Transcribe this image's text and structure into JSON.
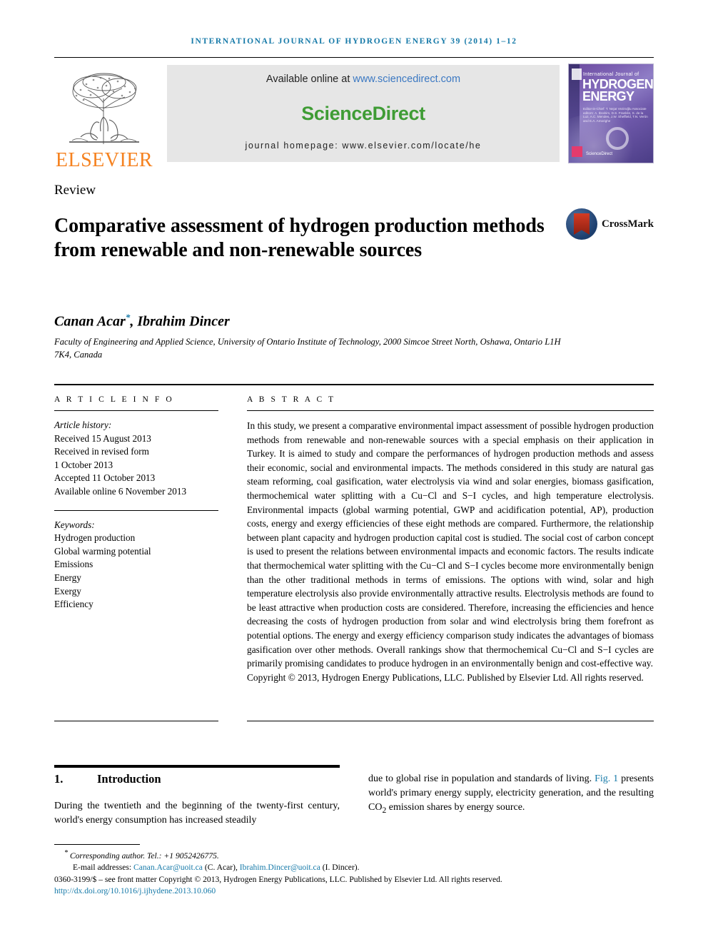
{
  "running_head": "International Journal of Hydrogen Energy 39 (2014) 1–12",
  "masthead": {
    "publisher_name": "ELSEVIER",
    "available_prefix": "Available online at ",
    "available_url": "www.sciencedirect.com",
    "brand": "ScienceDirect",
    "homepage": "journal homepage: www.elsevier.com/locate/he",
    "cover": {
      "line1": "International Journal of",
      "line2": "HYDROGEN",
      "line3": "ENERGY",
      "editors": "Editor-in-Chief: T. Nejat Veziroğlu  Associate editors: A. Ibrahim, D.S. Franklin, S. de la Luz, A.C. Mendes, J.W. Sheffield, T.N. Verón and E.A. Amorighe",
      "sciencedirect_mark": "ScienceDirect"
    }
  },
  "article": {
    "doctype": "Review",
    "title": "Comparative assessment of hydrogen production methods from renewable and non-renewable sources",
    "crossmark_label": "CrossMark",
    "authors": "Canan Acar",
    "author_star": "*",
    "authors_rest": ", Ibrahim Dincer",
    "affiliation": "Faculty of Engineering and Applied Science, University of Ontario Institute of Technology, 2000 Simcoe Street North, Oshawa, Ontario L1H 7K4, Canada"
  },
  "article_info": {
    "heading": "A R T I C L E  I N F O",
    "history_label": "Article history:",
    "history": [
      "Received 15 August 2013",
      "Received in revised form",
      "1 October 2013",
      "Accepted 11 October 2013",
      "Available online 6 November 2013"
    ],
    "keywords_label": "Keywords:",
    "keywords": [
      "Hydrogen production",
      "Global warming potential",
      "Emissions",
      "Energy",
      "Exergy",
      "Efficiency"
    ]
  },
  "abstract": {
    "heading": "A B S T R A C T",
    "text": "In this study, we present a comparative environmental impact assessment of possible hydrogen production methods from renewable and non-renewable sources with a special emphasis on their application in Turkey. It is aimed to study and compare the performances of hydrogen production methods and assess their economic, social and environmental impacts. The methods considered in this study are natural gas steam reforming, coal gasification, water electrolysis via wind and solar energies, biomass gasification, thermochemical water splitting with a Cu−Cl and S−I cycles, and high temperature electrolysis. Environmental impacts (global warming potential, GWP and acidification potential, AP), production costs, energy and exergy efficiencies of these eight methods are compared. Furthermore, the relationship between plant capacity and hydrogen production capital cost is studied. The social cost of carbon concept is used to present the relations between environmental impacts and economic factors. The results indicate that thermochemical water splitting with the Cu−Cl and S−I cycles become more environmentally benign than the other traditional methods in terms of emissions. The options with wind, solar and high temperature electrolysis also provide environmentally attractive results. Electrolysis methods are found to be least attractive when production costs are considered. Therefore, increasing the efficiencies and hence decreasing the costs of hydrogen production from solar and wind electrolysis bring them forefront as potential options. The energy and exergy efficiency comparison study indicates the advantages of biomass gasification over other methods. Overall rankings show that thermochemical Cu−Cl and S−I cycles are primarily promising candidates to produce hydrogen in an environmentally benign and cost-effective way.",
    "copyright": "Copyright © 2013, Hydrogen Energy Publications, LLC. Published by Elsevier Ltd. All rights reserved."
  },
  "body": {
    "section_number": "1.",
    "section_title": "Introduction",
    "col_left": "During the twentieth and the beginning of the twenty-first century, world's energy consumption has increased steadily",
    "col_right_part1": "due to global rise in population and standards of living. ",
    "col_right_link": "Fig. 1",
    "col_right_part2": " presents world's primary energy supply, electricity generation, and the resulting CO",
    "col_right_sub": "2",
    "col_right_part3": " emission shares by energy source."
  },
  "footnote": {
    "corresponding": "Corresponding author. Tel.: +1 9052426775.",
    "email_label": "E-mail addresses: ",
    "email1": "Canan.Acar@uoit.ca",
    "email1_name": " (C. Acar), ",
    "email2": "Ibrahim.Dincer@uoit.ca",
    "email2_name": " (I. Dincer).",
    "issn_line": "0360-3199/$ – see front matter Copyright © 2013, Hydrogen Energy Publications, LLC. Published by Elsevier Ltd. All rights reserved.",
    "doi": "http://dx.doi.org/10.1016/j.ijhydene.2013.10.060"
  },
  "colors": {
    "link_blue": "#1579a8",
    "sciencedirect_green": "#3f9c35",
    "elsevier_orange": "#f58220"
  }
}
